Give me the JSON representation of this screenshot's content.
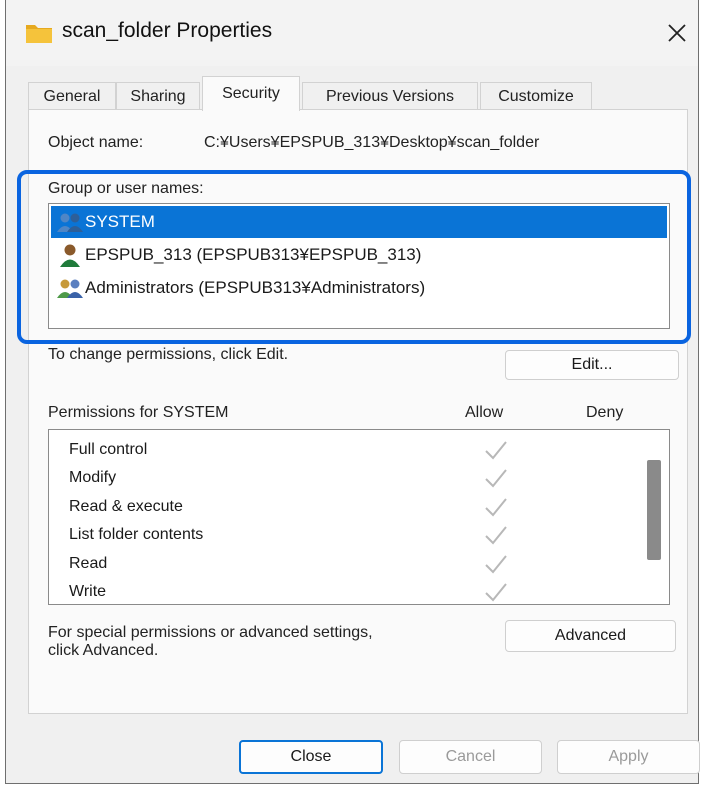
{
  "window": {
    "title": "scan_folder Properties",
    "close_glyph": "✕"
  },
  "tabs": [
    {
      "label": "General"
    },
    {
      "label": "Sharing"
    },
    {
      "label": "Security"
    },
    {
      "label": "Previous Versions"
    },
    {
      "label": "Customize"
    }
  ],
  "active_tab": "Security",
  "object": {
    "label": "Object name:",
    "value": "C:¥Users¥EPSPUB_313¥Desktop¥scan_folder"
  },
  "group_section": {
    "label": "Group or user names:",
    "users": [
      {
        "name": "SYSTEM",
        "icon": "user-group-icon",
        "selected": true
      },
      {
        "name": "EPSPUB_313 (EPSPUB313¥EPSPUB_313)",
        "icon": "user-icon",
        "selected": false
      },
      {
        "name": "Administrators (EPSPUB313¥Administrators)",
        "icon": "user-group-icon",
        "selected": false
      }
    ]
  },
  "change_permissions_text": "To change permissions, click Edit.",
  "edit_button": "Edit...",
  "permissions": {
    "title": "Permissions for SYSTEM",
    "allow_header": "Allow",
    "deny_header": "Deny",
    "rows": [
      {
        "name": "Full control",
        "allow": true,
        "deny": false
      },
      {
        "name": "Modify",
        "allow": true,
        "deny": false
      },
      {
        "name": "Read & execute",
        "allow": true,
        "deny": false
      },
      {
        "name": "List folder contents",
        "allow": true,
        "deny": false
      },
      {
        "name": "Read",
        "allow": true,
        "deny": false
      },
      {
        "name": "Write",
        "allow": true,
        "deny": false
      }
    ]
  },
  "advanced_text_line1": "For special permissions or advanced settings,",
  "advanced_text_line2": "click Advanced.",
  "advanced_button": "Advanced",
  "footer": {
    "close": "Close",
    "cancel": "Cancel",
    "apply": "Apply"
  },
  "colors": {
    "accent": "#0a74d6",
    "highlight_frame": "#0a64e0",
    "check_disabled": "#b8b8b8"
  }
}
